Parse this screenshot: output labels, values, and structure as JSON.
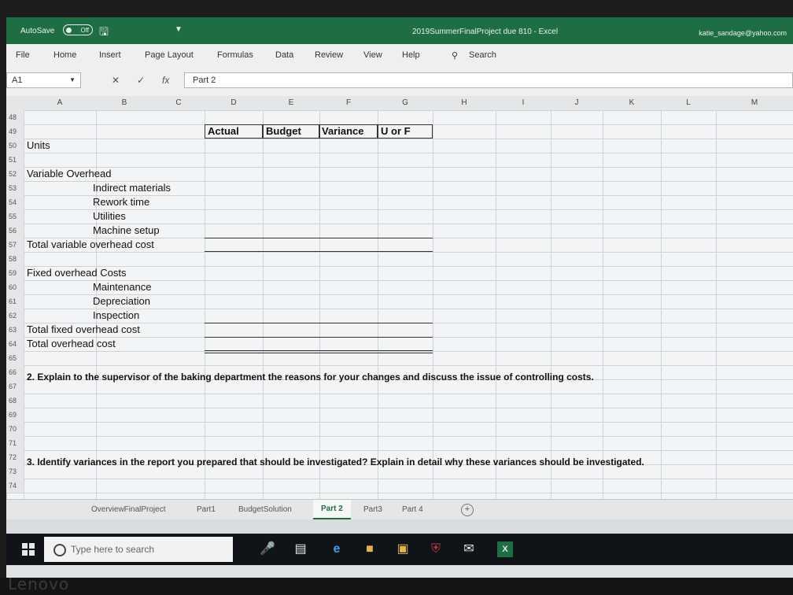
{
  "titlebar": {
    "autosave_label": "AutoSave",
    "autosave_state": "Off",
    "document_title": "2019SummerFinalProject due 810  -  Excel",
    "user": "katie_sandage@yahoo.com"
  },
  "ribbon_tabs": [
    "File",
    "Home",
    "Insert",
    "Page Layout",
    "Formulas",
    "Data",
    "Review",
    "View",
    "Help",
    "Search"
  ],
  "formula_bar": {
    "name_box": "A1",
    "fx": "fx",
    "value": "Part 2"
  },
  "columns": [
    "A",
    "B",
    "C",
    "D",
    "E",
    "F",
    "G",
    "H",
    "I",
    "J",
    "K",
    "L",
    "M"
  ],
  "rows": [
    "48",
    "49",
    "50",
    "51",
    "52",
    "53",
    "54",
    "55",
    "56",
    "57",
    "58",
    "59",
    "60",
    "61",
    "62",
    "63",
    "64",
    "65",
    "66",
    "67",
    "68",
    "69",
    "70",
    "71",
    "72",
    "73",
    "74"
  ],
  "sheet": {
    "headers": {
      "actual": "Actual",
      "budget": "Budget",
      "variance": "Variance",
      "u_or_f": "U or F"
    },
    "units": "Units",
    "variable_overhead": "Variable Overhead",
    "indirect_materials": "Indirect materials",
    "rework_time": "Rework time",
    "utilities": "Utilities",
    "machine_setup": "Machine setup",
    "total_variable": "Total variable overhead cost",
    "fixed_overhead": "Fixed overhead Costs",
    "maintenance": "Maintenance",
    "depreciation": "Depreciation",
    "inspection": "Inspection",
    "total_fixed": "Total fixed overhead cost",
    "total_overhead": "Total overhead cost",
    "question2": "2.  Explain to the supervisor of the baking department the reasons for your changes and discuss the issue of controlling costs.",
    "question3": "3.  Identify variances in the report you prepared that should be investigated?  Explain in detail why these variances should be investigated."
  },
  "sheet_tabs": [
    "OverviewFinalProject",
    "Part1",
    "BudgetSolution",
    "Part 2",
    "Part3",
    "Part 4"
  ],
  "active_tab": "Part 2",
  "taskbar": {
    "search_placeholder": "Type here to search"
  },
  "bezel_brand": "Lenovo",
  "colors": {
    "excel_green": "#1f6e43",
    "taskbar": "#101418"
  }
}
